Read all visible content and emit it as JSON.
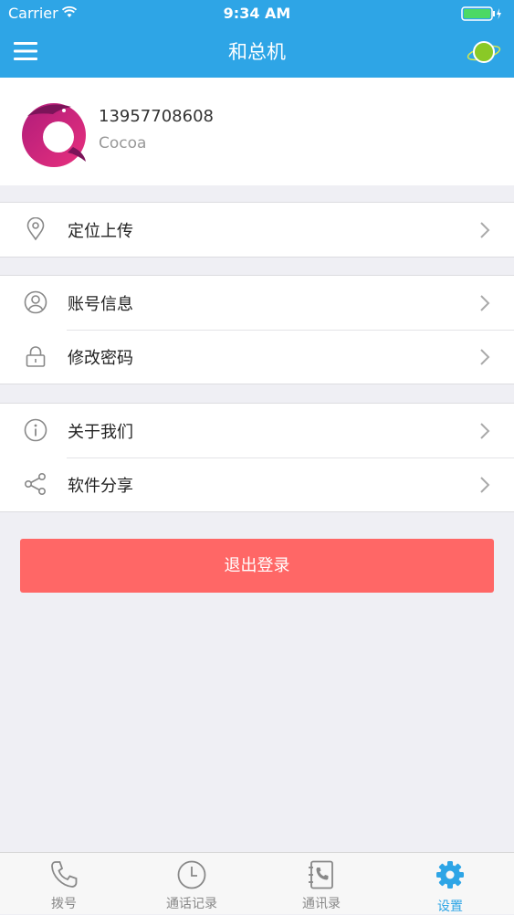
{
  "status_bar": {
    "carrier": "Carrier",
    "time": "9:34 AM"
  },
  "nav": {
    "title": "和总机",
    "menu_icon": "hamburger-menu-icon",
    "right_icon": "planet-icon"
  },
  "profile": {
    "phone": "13957708608",
    "nickname": "Cocoa",
    "avatar_icon": "rx-logo-avatar"
  },
  "sections": [
    {
      "items": [
        {
          "label": "定位上传",
          "icon": "location-pin-icon"
        }
      ]
    },
    {
      "items": [
        {
          "label": "账号信息",
          "icon": "user-icon"
        },
        {
          "label": "修改密码",
          "icon": "lock-icon"
        }
      ]
    },
    {
      "items": [
        {
          "label": "关于我们",
          "icon": "info-icon"
        },
        {
          "label": "软件分享",
          "icon": "share-icon"
        }
      ]
    }
  ],
  "logout_label": "退出登录",
  "tabbar": {
    "tabs": [
      {
        "label": "拨号",
        "icon": "phone-icon"
      },
      {
        "label": "通话记录",
        "icon": "clock-icon"
      },
      {
        "label": "通讯录",
        "icon": "contacts-book-icon"
      },
      {
        "label": "设置",
        "icon": "gear-icon"
      }
    ],
    "active": "设置"
  },
  "colors": {
    "brand": "#2ea5e6",
    "logout": "#ff6766",
    "background": "#efeff4"
  }
}
